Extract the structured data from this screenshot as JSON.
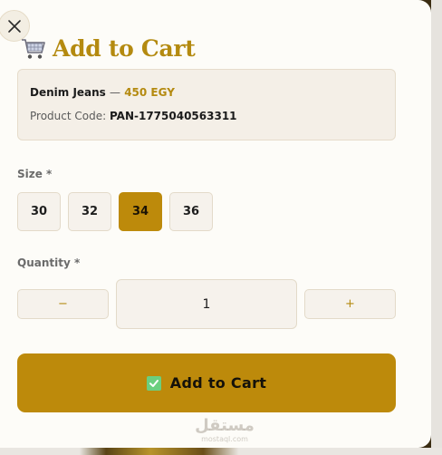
{
  "modal": {
    "title": "Add to Cart",
    "product": {
      "name": "Denim Jeans",
      "separator": "—",
      "price": "450 EGY",
      "code_label": "Product Code:",
      "code": "PAN-1775040563311"
    },
    "size": {
      "label": "Size *",
      "options": [
        "30",
        "32",
        "34",
        "36"
      ],
      "selected": "34"
    },
    "quantity": {
      "label": "Quantity *",
      "minus": "−",
      "plus": "+",
      "value": "1"
    },
    "submit_label": "Add to Cart",
    "accent_color": "#bd8a0b"
  },
  "watermark": {
    "arabic": "مستقل",
    "latin": "mostaql.com"
  }
}
